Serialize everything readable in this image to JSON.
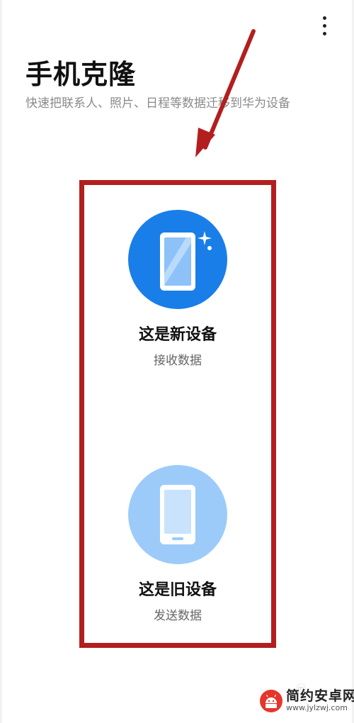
{
  "header": {
    "title": "手机克隆",
    "subtitle": "快速把联系人、照片、日程等数据迁移到华为设备"
  },
  "options": {
    "new_device": {
      "label": "这是新设备",
      "sublabel": "接收数据",
      "icon": "phone-sparkle-icon",
      "color": "#1a7ee8"
    },
    "old_device": {
      "label": "这是旧设备",
      "sublabel": "发送数据",
      "icon": "phone-icon",
      "color": "#9ccbfa"
    }
  },
  "annotation": {
    "color": "#b31e1e"
  },
  "watermark": {
    "name": "简约安卓网",
    "url": "www.jylzwj.com"
  }
}
